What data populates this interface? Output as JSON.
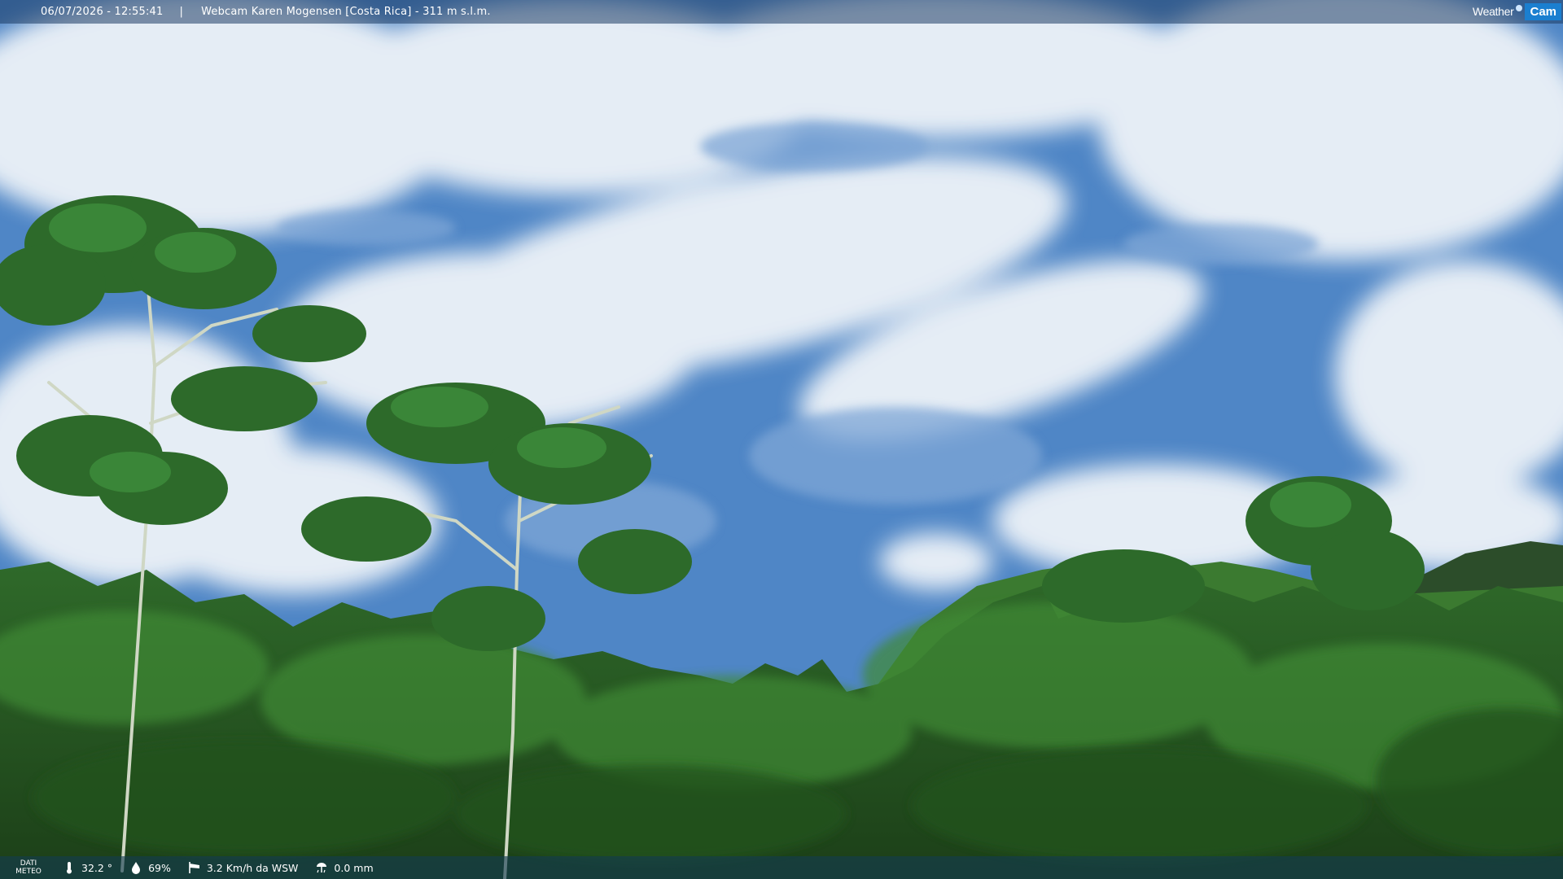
{
  "header": {
    "datetime": "06/07/2026 - 12:55:41",
    "separator": "|",
    "title": "Webcam Karen Mogensen [Costa Rica]  - 311 m s.l.m."
  },
  "brand": {
    "weather": "Weather",
    "cam": "Cam"
  },
  "footer": {
    "meteo_label_line1": "DATI",
    "meteo_label_line2": "METEO",
    "temperature": "32.2 °",
    "humidity": "69%",
    "wind": "3.2 Km/h da WSW",
    "rain": "0.0 mm"
  },
  "icons": {
    "temperature": "thermometer-icon",
    "humidity": "humidity-drop-icon",
    "wind": "windsock-icon",
    "rain": "rain-gauge-icon"
  }
}
